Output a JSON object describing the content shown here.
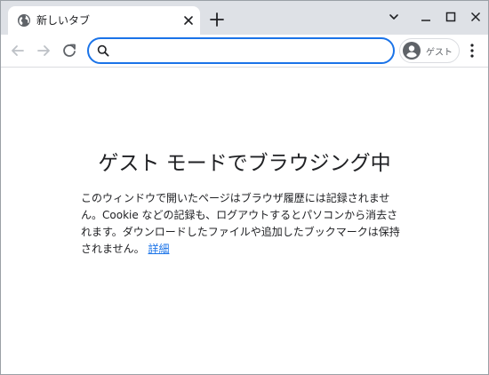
{
  "tab": {
    "title": "新しいタブ",
    "favicon": "globe-icon"
  },
  "toolbar": {
    "omnibox_value": "",
    "profile_label": "ゲスト"
  },
  "content": {
    "heading": "ゲスト モードでブラウジング中",
    "description": "このウィンドウで開いたページはブラウザ履歴には記録されません。Cookie などの記録も、ログアウトするとパソコンから消去されます。ダウンロードしたファイルや追加したブックマークは保持されません。",
    "learn_more": "詳細"
  },
  "colors": {
    "accent": "#1a73e8",
    "tabstrip_bg": "#dee1e6",
    "text": "#202124",
    "icon": "#5f6368"
  }
}
